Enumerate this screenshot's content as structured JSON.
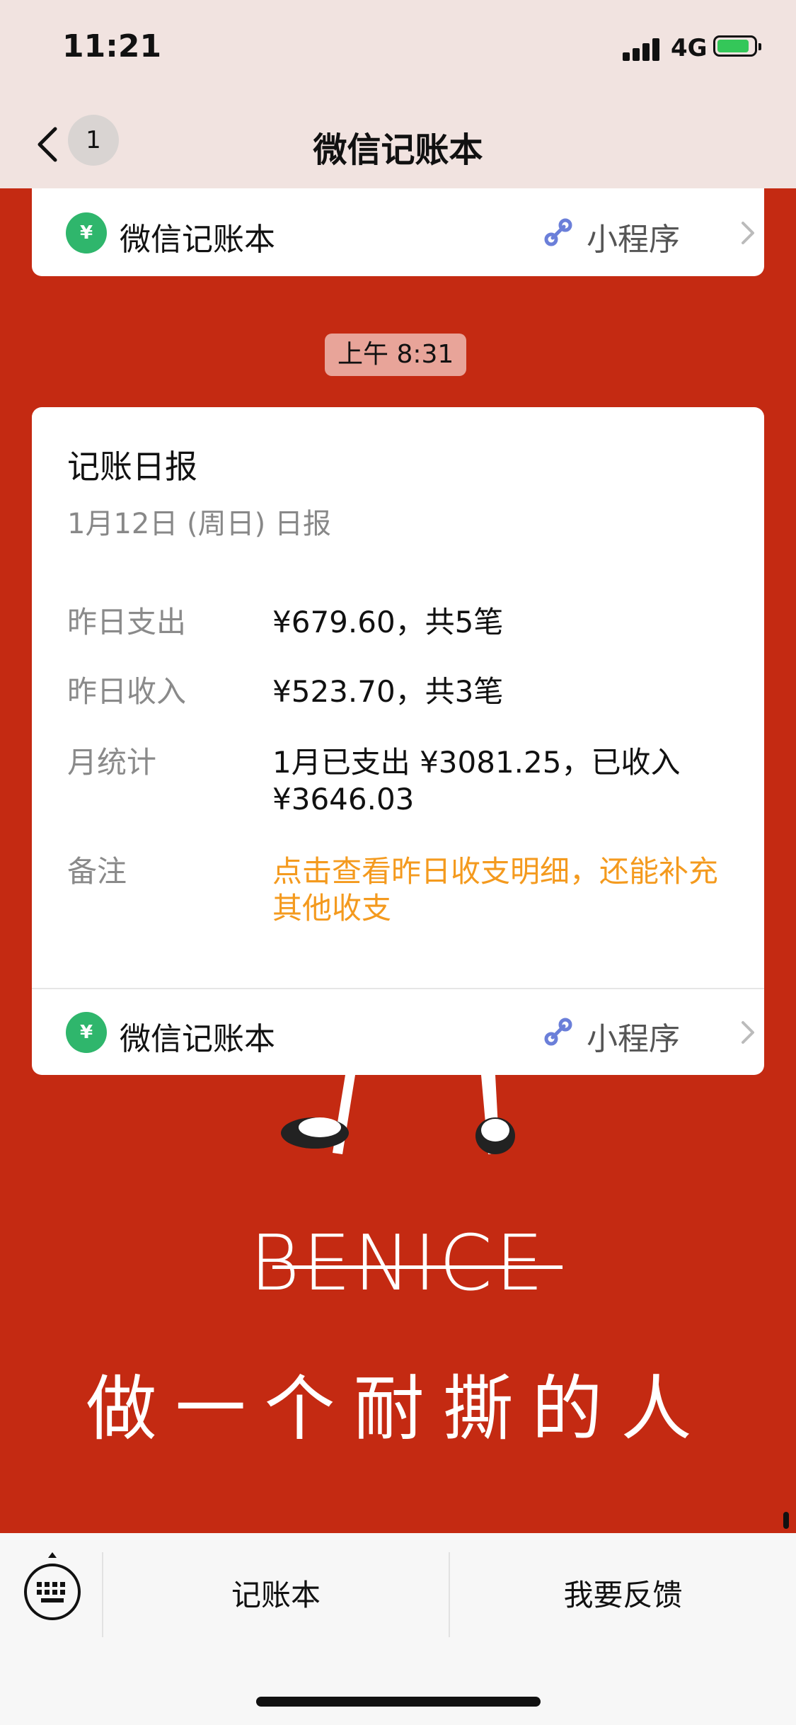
{
  "status": {
    "time": "11:21",
    "network": "4G"
  },
  "nav": {
    "badge": "1",
    "title": "微信记账本"
  },
  "miniapp": {
    "name": "微信记账本",
    "tag": "小程序",
    "logo_text": "¥"
  },
  "timestamp": "上午 8:31",
  "report": {
    "title": "记账日报",
    "subtitle": "1月12日 (周日) 日报",
    "rows": [
      {
        "label": "昨日支出",
        "value": "¥679.60，共5笔"
      },
      {
        "label": "昨日收入",
        "value": "¥523.70，共3笔"
      },
      {
        "label": "月统计",
        "value_line1": "1月已支出 ¥3081.25，已收入",
        "value_line2": "¥3646.03"
      },
      {
        "label": "备注",
        "value_line1": "点击查看昨日收支明细，还能补充",
        "value_line2": "其他收支"
      }
    ]
  },
  "background": {
    "brand": "BENICE",
    "slogan": "做一个耐撕的人"
  },
  "bottom_menu": {
    "item1": "记账本",
    "item2": "我要反馈"
  },
  "colors": {
    "background_red": "#c42a12",
    "accent_orange": "#f49a1e",
    "logo_green": "#2fb66c",
    "battery_green": "#34c759"
  }
}
